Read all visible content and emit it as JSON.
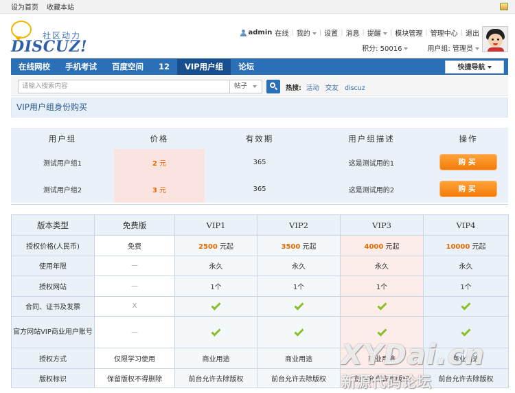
{
  "topbar": {
    "set_home": "设为首页",
    "bookmark": "收藏本站"
  },
  "logo": {
    "tagline": "社区动力",
    "wordmark": "DISCUZ!"
  },
  "user": {
    "username": "admin",
    "online": "在线",
    "menu": [
      "我的",
      "设置",
      "消息",
      "提醒",
      "模块管理",
      "管理中心",
      "退出"
    ],
    "points": "积分: 50016",
    "group": "用户组: 管理员"
  },
  "nav": {
    "tabs": [
      "在线网校",
      "手机考试",
      "百度空间",
      "12",
      "VIP用户组",
      "论坛"
    ],
    "active_index": 4,
    "quick_nav": "快捷导航"
  },
  "search": {
    "placeholder": "请输入搜索内容",
    "type": "帖子",
    "hot_label": "热搜:",
    "hot_links": [
      "活动",
      "交友",
      "discuz"
    ]
  },
  "page_title": "VIP用户组身份购买",
  "group_table": {
    "headers": [
      "用户组",
      "价格",
      "有效期",
      "用户组描述",
      "操作"
    ],
    "rows": [
      {
        "name": "测试用户组1",
        "price": "2",
        "unit": "元",
        "validity": "365",
        "desc": "这是测试用的1",
        "action": "购买"
      },
      {
        "name": "测试用户组2",
        "price": "3",
        "unit": "元",
        "validity": "365",
        "desc": "这是测试用的2",
        "action": "购买"
      }
    ]
  },
  "version_table": {
    "headers": [
      "版本类型",
      "免费版",
      "VIP1",
      "VIP2",
      "VIP3",
      "VIP4"
    ],
    "rows": [
      {
        "label": "授权价格(人民币)",
        "cells": [
          {
            "text": "免费"
          },
          {
            "amount": "2500",
            "suffix": "元起"
          },
          {
            "amount": "3500",
            "suffix": "元起"
          },
          {
            "amount": "4000",
            "suffix": "元起"
          },
          {
            "amount": "10000",
            "suffix": "元起"
          }
        ]
      },
      {
        "label": "使用年限",
        "cells": [
          {
            "text": "—"
          },
          {
            "text": "永久"
          },
          {
            "text": "永久"
          },
          {
            "text": "永久"
          },
          {
            "text": "永久"
          }
        ]
      },
      {
        "label": "授权网站",
        "cells": [
          {
            "text": "—"
          },
          {
            "text": "1个"
          },
          {
            "text": "1个"
          },
          {
            "text": "1个"
          },
          {
            "text": "1个"
          }
        ]
      },
      {
        "label": "合同、证书及发票",
        "cells": [
          {
            "text": "X"
          },
          {
            "check": true
          },
          {
            "check": true
          },
          {
            "check": true
          },
          {
            "check": true
          }
        ]
      },
      {
        "label": "官方网站VIP商业用户账号",
        "cells": [
          {
            "text": "—"
          },
          {
            "check": true
          },
          {
            "check": true
          },
          {
            "check": true
          },
          {
            "check": true
          }
        ]
      },
      {
        "label": "授权方式",
        "cells": [
          {
            "text": "仅限学习使用"
          },
          {
            "text": "商业用途"
          },
          {
            "text": "商业用途"
          },
          {
            "text": "商业用途"
          },
          {
            "text": "商业用途"
          }
        ]
      },
      {
        "label": "版权标识",
        "cells": [
          {
            "text": "保留版权不得删除"
          },
          {
            "text": "前台允许去除版权"
          },
          {
            "text": "前台允许去除版权"
          },
          {
            "text": "前台允许去除版权"
          },
          {
            "text": "前台允许去除版权"
          }
        ]
      }
    ]
  },
  "watermark": {
    "line1": "XYDai.cn",
    "line2": "新源代码论坛"
  },
  "colors": {
    "nav_blue": "#2b6fb7",
    "buy_orange": "#f37b09",
    "price_orange": "#e56a00",
    "check_green": "#8bbf2a"
  }
}
